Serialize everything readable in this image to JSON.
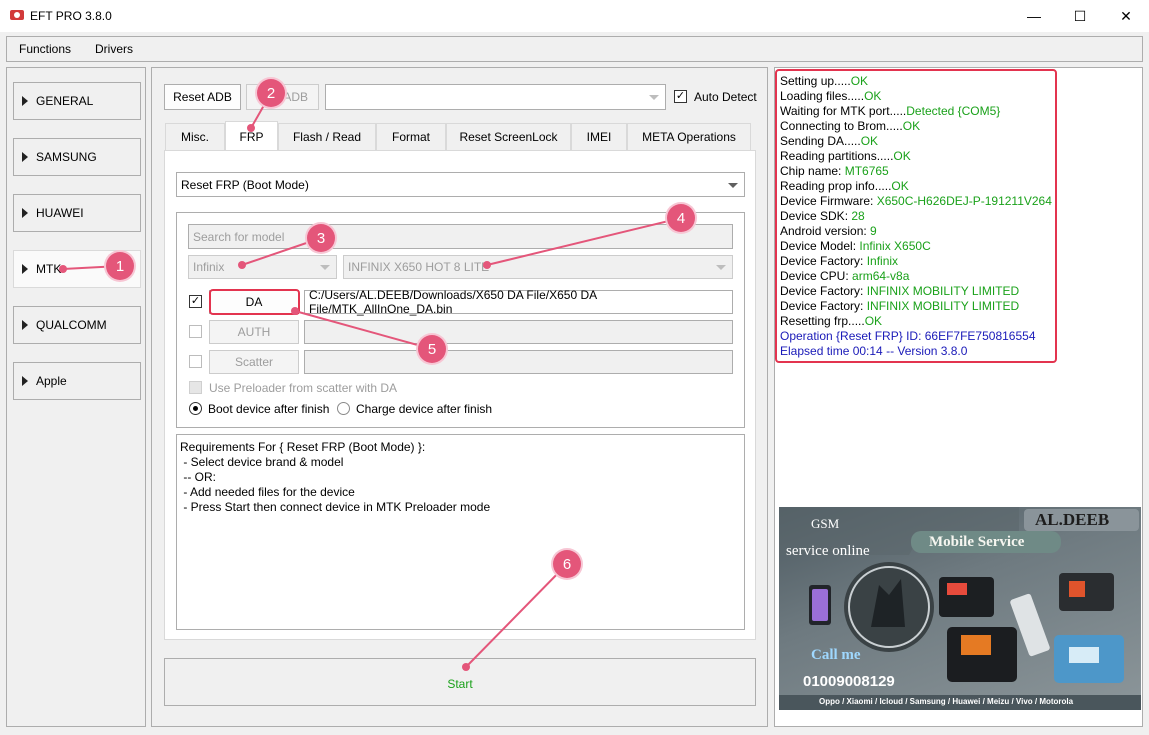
{
  "window": {
    "title": "EFT PRO 3.8.0",
    "minimize_glyph": "—",
    "maximize_glyph": "☐",
    "close_glyph": "✕"
  },
  "menu": [
    "Functions",
    "Drivers"
  ],
  "brands": [
    "GENERAL",
    "SAMSUNG",
    "HUAWEI",
    "MTK",
    "QUALCOMM",
    "Apple"
  ],
  "toolbar": {
    "reset_adb": "Reset ADB",
    "adb_button": "ADB",
    "port_select": "",
    "auto_detect": "Auto Detect"
  },
  "tabs": [
    "Misc.",
    "FRP",
    "Flash / Read",
    "Format",
    "Reset ScreenLock",
    "IMEI",
    "META Operations"
  ],
  "frp": {
    "mode_select": "Reset FRP (Boot Mode)",
    "search_placeholder": "Search for model",
    "brand_select": "Infinix",
    "model_select": "INFINIX X650 HOT 8 LITE",
    "da_button": "DA",
    "da_path": "C:/Users/AL.DEEB/Downloads/X650 DA File/X650 DA File/MTK_AllInOne_DA.bin",
    "auth_button": "AUTH",
    "auth_path": "",
    "scatter_button": "Scatter",
    "scatter_path": "",
    "use_preloader_label": "Use Preloader from scatter with DA",
    "boot_after_label": "Boot device after finish",
    "charge_after_label": "Charge device after finish"
  },
  "requirements": "Requirements For { Reset FRP (Boot Mode) }:\n - Select device brand & model\n -- OR:\n - Add needed files for the device\n - Press Start then connect device in MTK Preloader mode",
  "start_label": "Start",
  "log": [
    {
      "label": "Setting up.....",
      "value": "OK",
      "color": "green"
    },
    {
      "label": "Loading files.....",
      "value": "OK",
      "color": "green"
    },
    {
      "label": "Waiting for MTK port.....",
      "value": "Detected {COM5}",
      "color": "green"
    },
    {
      "label": "Connecting to Brom.....",
      "value": "OK",
      "color": "green"
    },
    {
      "label": "Sending DA.....",
      "value": "OK",
      "color": "green"
    },
    {
      "label": "Reading partitions.....",
      "value": "OK",
      "color": "green"
    },
    {
      "label": "Chip name: ",
      "value": "MT6765",
      "color": "green"
    },
    {
      "label": "Reading prop info.....",
      "value": "OK",
      "color": "green"
    },
    {
      "label": "Device Firmware: ",
      "value": "X650C-H626DEJ-P-191211V264",
      "color": "green"
    },
    {
      "label": "Device SDK: ",
      "value": "28",
      "color": "green"
    },
    {
      "label": "Android version: ",
      "value": "9",
      "color": "green"
    },
    {
      "label": "Device Model: ",
      "value": "Infinix X650C",
      "color": "green"
    },
    {
      "label": "Device Factory: ",
      "value": "Infinix",
      "color": "green"
    },
    {
      "label": "Device CPU: ",
      "value": "arm64-v8a",
      "color": "green"
    },
    {
      "label": "Device Factory: ",
      "value": "INFINIX MOBILITY LIMITED",
      "color": "green"
    },
    {
      "label": "Device Factory: ",
      "value": "INFINIX MOBILITY LIMITED",
      "color": "green"
    },
    {
      "label": "Resetting frp.....",
      "value": "OK",
      "color": "green"
    },
    {
      "label": "",
      "value": "Operation {Reset FRP} ID: 66EF7FE750816554",
      "color": "blue"
    },
    {
      "label": "",
      "value": "Elapsed time 00:14 -- Version 3.8.0",
      "color": "blue"
    }
  ],
  "banner": {
    "gsm": "GSM",
    "service_online": "service online",
    "name": "AL.DEEB",
    "mobile_service": "Mobile Service",
    "call_me": "Call me",
    "phone": "01009008129",
    "brands_line": "Oppo / Xiaomi / Icloud / Samsung / Huawei / Meizu / Vivo / Motorola"
  },
  "annotations": [
    "1",
    "2",
    "3",
    "4",
    "5",
    "6"
  ],
  "colors": {
    "ok_green": "#1aa11a",
    "info_blue": "#1a1ab8",
    "annotation_pink": "#e4567a",
    "highlight_red": "#e3344f"
  }
}
